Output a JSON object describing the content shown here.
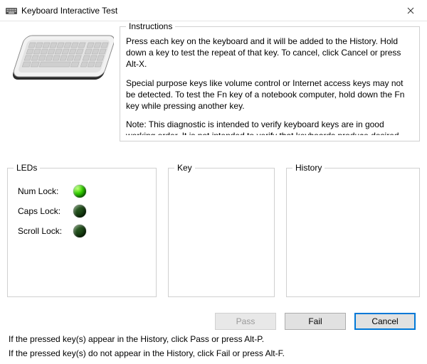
{
  "window": {
    "title": "Keyboard Interactive Test"
  },
  "instructions": {
    "legend": "Instructions",
    "p1": "Press each key on the keyboard and it will be added to the History. Hold down a key to test the repeat of that key. To cancel, click Cancel or press Alt-X.",
    "p2": "Special purpose keys like volume control or Internet access keys may not be detected. To test the Fn key of a notebook computer, hold down the Fn key while pressing another key.",
    "p3": "Note: This diagnostic is intended to verify keyboard keys are in good working order. It is not intended to verify that keyboards produce desired characters based on regional settings or configuration."
  },
  "leds": {
    "legend": "LEDs",
    "items": [
      {
        "label": "Num Lock:",
        "on": true
      },
      {
        "label": "Caps Lock:",
        "on": false
      },
      {
        "label": "Scroll Lock:",
        "on": false
      }
    ]
  },
  "key": {
    "legend": "Key"
  },
  "history": {
    "legend": "History"
  },
  "buttons": {
    "pass": "Pass",
    "fail": "Fail",
    "cancel": "Cancel"
  },
  "footer": {
    "line1": "If the pressed key(s) appear in the History, click Pass or press Alt-P.",
    "line2": "If the pressed key(s) do not appear in the History, click Fail or press Alt-F."
  }
}
